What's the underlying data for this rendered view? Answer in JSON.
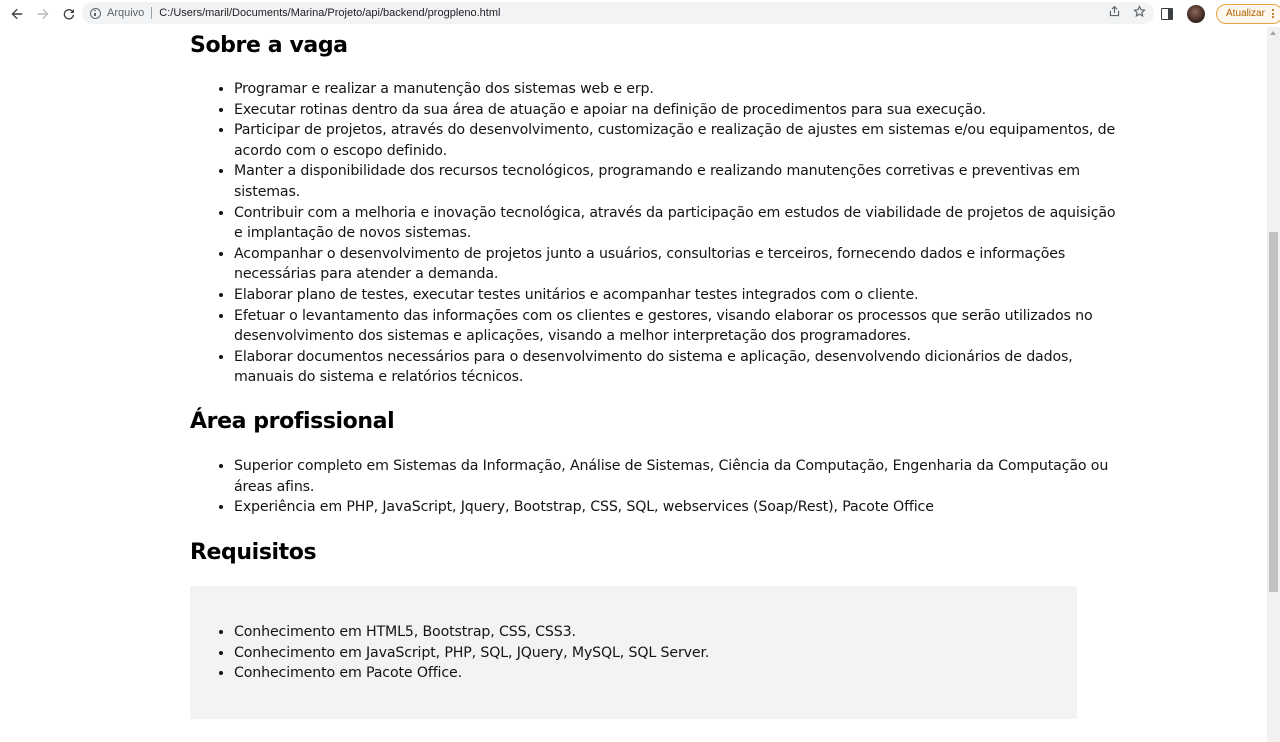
{
  "browser": {
    "scheme_label": "Arquivo",
    "url": "C:/Users/maril/Documents/Marina/Projeto/api/backend/progpleno.html",
    "update_label": "Atualizar",
    "icons": {
      "back": "arrow-left-icon",
      "forward": "arrow-right-icon",
      "reload": "reload-icon",
      "info": "info-icon",
      "share": "share-icon",
      "bookmark": "star-icon",
      "side_panel": "side-panel-icon",
      "menu": "kebab-menu-icon"
    },
    "colors": {
      "update_accent": "#b06000",
      "omnibox_bg": "#f1f3f4"
    }
  },
  "page": {
    "sobre": {
      "heading": "Sobre a vaga",
      "items": [
        "Programar e realizar a manutenção dos sistemas web e erp.",
        "Executar rotinas dentro da sua área de atuação e apoiar na definição de procedimentos para sua execução.",
        "Participar de projetos, através do desenvolvimento, customização e realização de ajustes em sistemas e/ou equipamentos, de acordo com o escopo definido.",
        "Manter a disponibilidade dos recursos tecnológicos, programando e realizando manutenções corretivas e preventivas em sistemas.",
        "Contribuir com a melhoria e inovação tecnológica, através da participação em estudos de viabilidade de projetos de aquisição e implantação de novos sistemas.",
        "Acompanhar o desenvolvimento de projetos junto a usuários, consultorias e terceiros, fornecendo dados e informações necessárias para atender a demanda.",
        "Elaborar plano de testes, executar testes unitários e acompanhar testes integrados com o cliente.",
        "Efetuar o levantamento das informações com os clientes e gestores, visando elaborar os processos que serão utilizados no desenvolvimento dos sistemas e aplicações, visando a melhor interpretação dos programadores.",
        "Elaborar documentos necessários para o desenvolvimento do sistema e aplicação, desenvolvendo dicionários de dados, manuais do sistema e relatórios técnicos."
      ]
    },
    "area": {
      "heading": "Área profissional",
      "items": [
        "Superior completo em Sistemas da Informação, Análise de Sistemas, Ciência da Computação, Engenharia da Computação ou áreas afins.",
        "Experiência em PHP, JavaScript, Jquery, Bootstrap, CSS, SQL, webservices (Soap/Rest), Pacote Office"
      ]
    },
    "requisitos": {
      "heading": "Requisitos",
      "items": [
        "Conhecimento em HTML5, Bootstrap, CSS, CSS3.",
        "Conhecimento em JavaScript, PHP, SQL, JQuery, MySQL, SQL Server.",
        "Conhecimento em Pacote Office."
      ]
    }
  }
}
